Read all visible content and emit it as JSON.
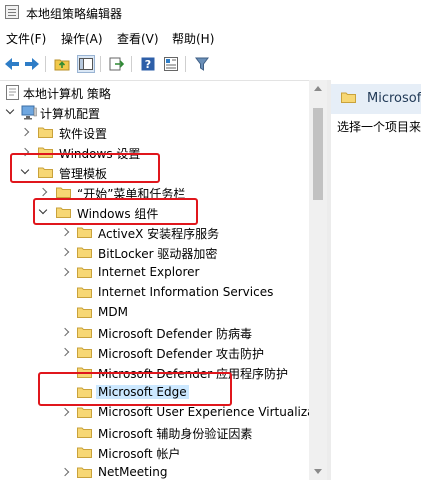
{
  "window": {
    "title": "本地组策略编辑器"
  },
  "menu": {
    "file": "文件(F)",
    "action": "操作(A)",
    "view": "查看(V)",
    "help": "帮助(H)"
  },
  "toolbar": {
    "icons": [
      "back-arrow-icon",
      "forward-arrow-icon",
      "up-folder-icon",
      "show-hide-tree-icon",
      "export-list-icon",
      "help-icon",
      "properties-icon",
      "filter-icon"
    ]
  },
  "tree": {
    "root": "本地计算机 策略",
    "computer_config": "计算机配置",
    "software_settings": "软件设置",
    "windows_settings": "Windows 设置",
    "admin_templates": "管理模板",
    "start_menu": "“开始”菜单和任务栏",
    "windows_components": "Windows 组件",
    "activex": "ActiveX 安装程序服务",
    "bitlocker": "BitLocker 驱动器加密",
    "ie": "Internet Explorer",
    "iis": "Internet Information Services",
    "mdm": "MDM",
    "defender_av": "Microsoft Defender 防病毒",
    "defender_exploit": "Microsoft Defender 攻击防护",
    "defender_app": "Microsoft Defender 应用程序防护",
    "edge": "Microsoft Edge",
    "user_experience": "Microsoft User Experience Virtualization",
    "auth_factors": "Microsoft 辅助身份验证因素",
    "account": "Microsoft 帐户",
    "netmeeting": "NetMeeting"
  },
  "right_pane": {
    "header_title": "Microsoft Edge",
    "description": "选择一个项目来查看它的描述。"
  },
  "colors": {
    "highlight": "#e0161c",
    "folder": "#f7d774",
    "selected": "#cce8ff",
    "header_bg": "#e6eef7"
  }
}
